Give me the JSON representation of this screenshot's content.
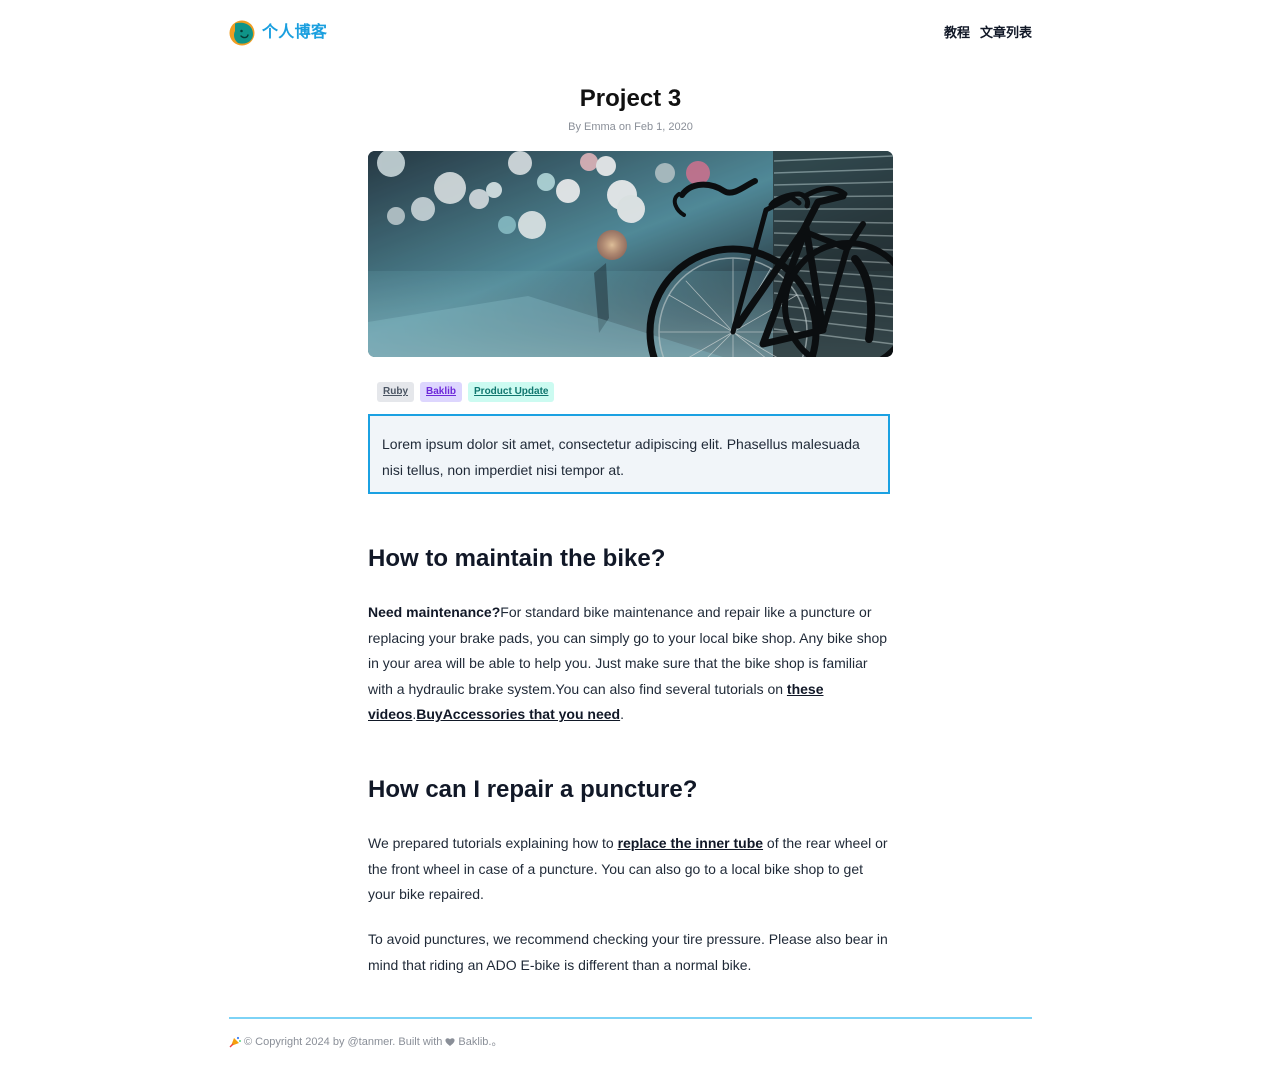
{
  "site": {
    "brand_name": "个人博客",
    "logo_icon": "smiling-leaf-logo",
    "colors": {
      "brand": "#1a9fdf",
      "callout_border": "#1ba1e2",
      "callout_background": "#f1f5f9",
      "divider": "#7dd3f6"
    }
  },
  "nav": {
    "items": [
      {
        "label": "教程"
      },
      {
        "label": "文章列表"
      }
    ]
  },
  "article": {
    "title": "Project 3",
    "meta": "By Emma on Feb 1, 2020",
    "hero_image": "bicycle-on-city-street-night-bokeh",
    "tags": [
      {
        "label": "Ruby",
        "color": "#4b5563",
        "background": "#e5e7eb"
      },
      {
        "label": "Baklib",
        "color": "#6d28d9",
        "background": "#ddd6fe"
      },
      {
        "label": "Product Update",
        "color": "#0f766e",
        "background": "#ccfbf1"
      }
    ],
    "callout": "Lorem ipsum dolor sit amet, consectetur adipiscing elit. Phasellus malesuada nisi tellus, non imperdiet nisi tempor at.",
    "sections": [
      {
        "heading": "How to maintain the bike?",
        "paragraph": {
          "bold_lead": "Need maintenance?",
          "text_1": "For standard bike maintenance and repair like a puncture or replacing your brake pads, you can simply go to your local bike shop. Any bike shop in your area will be able to help you. Just make sure that the bike shop is familiar with a hydraulic brake system.You can also find several tutorials on ",
          "link_1": "these videos",
          "text_2": ".",
          "link_2": "BuyAccessories that you need",
          "text_3": "."
        }
      },
      {
        "heading": "How can I repair a puncture?",
        "paragraph_1": {
          "text_1": "We prepared tutorials explaining how to ",
          "link": "replace the inner tube",
          "text_2": " of the rear wheel or the front wheel in case of a puncture. You can also go to a local bike shop to get your bike repaired."
        },
        "paragraph_2": "To avoid punctures, we recommend checking your tire pressure. Please also bear in mind that riding an ADO E-bike is different than a normal bike."
      }
    ]
  },
  "footer": {
    "icon": "sparkle-icon",
    "text_before_heart": "© Copyright 2024 by @tanmer. Built with",
    "heart_icon": "heart-icon",
    "text_after_heart": "Baklib.。"
  }
}
